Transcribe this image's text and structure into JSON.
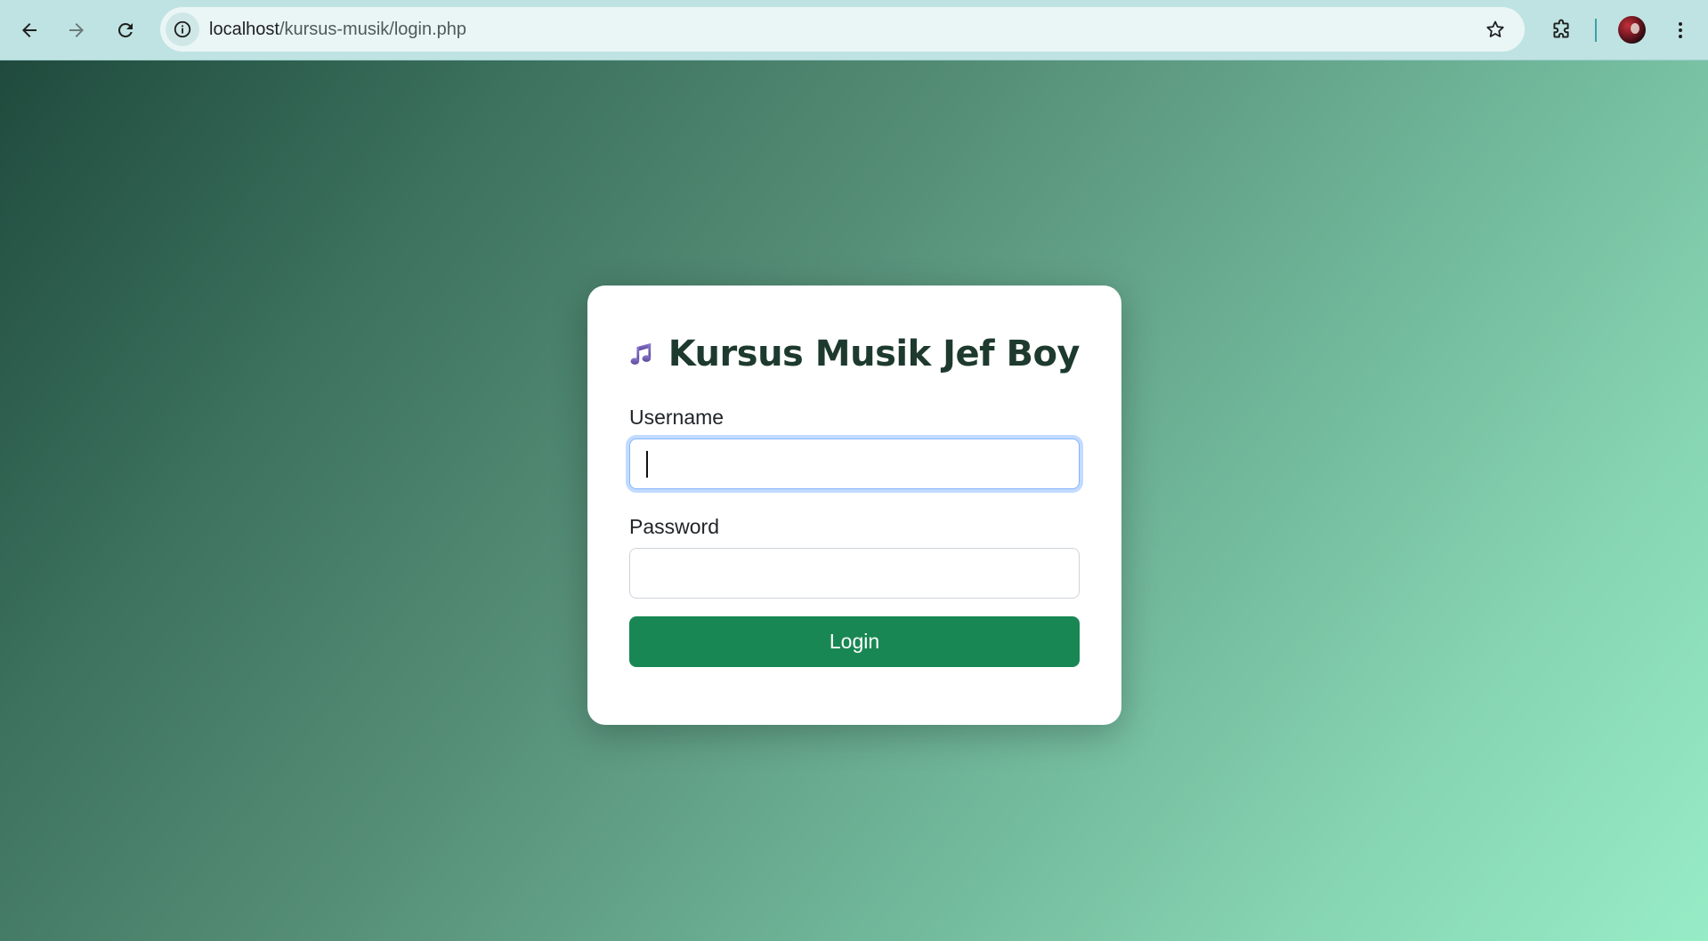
{
  "browser": {
    "url_host": "localhost",
    "url_path": "/kursus-musik/login.php"
  },
  "page": {
    "title": "Kursus Musik Jef Boy",
    "title_icon": "music-note-icon",
    "username_label": "Username",
    "username_value": "",
    "password_label": "Password",
    "password_value": "",
    "login_label": "Login"
  },
  "colors": {
    "button_green": "#198754",
    "title_dark_green": "#1e3a2f",
    "gradient_start": "#1f4a3d",
    "gradient_end": "#97ecc6",
    "focus_ring": "#86b7fe",
    "browser_toolbar": "#bfe3e2"
  }
}
